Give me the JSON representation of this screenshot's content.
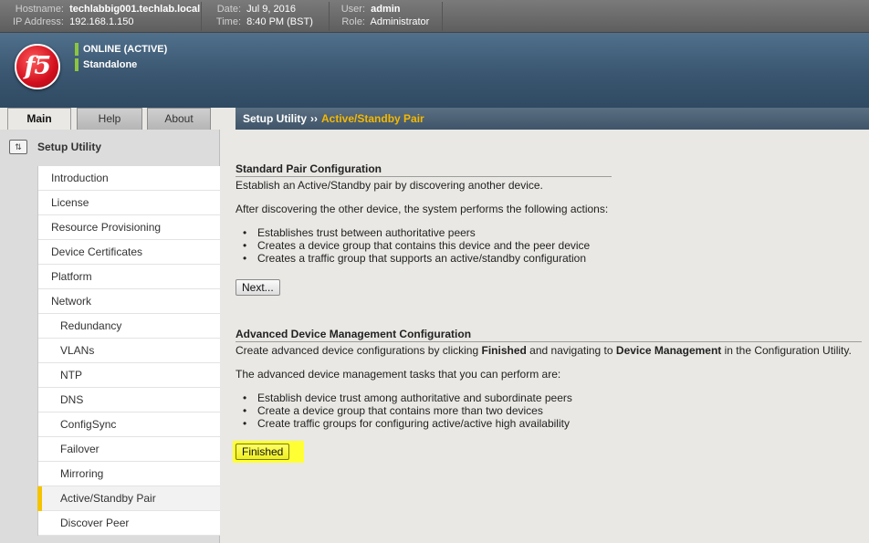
{
  "topbar": {
    "hostname_label": "Hostname:",
    "hostname": "techlabbig001.techlab.local",
    "ip_label": "IP Address:",
    "ip": "192.168.1.150",
    "date_label": "Date:",
    "date": "Jul 9, 2016",
    "time_label": "Time:",
    "time": "8:40 PM (BST)",
    "user_label": "User:",
    "user": "admin",
    "role_label": "Role:",
    "role": "Administrator"
  },
  "header": {
    "logo_text": "f5",
    "status_online": "ONLINE (ACTIVE)",
    "status_mode": "Standalone",
    "status_color": "#8cc63f"
  },
  "tabs": [
    {
      "label": "Main",
      "active": true
    },
    {
      "label": "Help",
      "active": false
    },
    {
      "label": "About",
      "active": false
    }
  ],
  "breadcrumb": {
    "root": "Setup Utility",
    "separator": "››",
    "current": "Active/Standby Pair"
  },
  "sidebar": {
    "title": "Setup Utility",
    "icon": "setup-utility-icon",
    "items": [
      {
        "label": "Introduction"
      },
      {
        "label": "License"
      },
      {
        "label": "Resource Provisioning"
      },
      {
        "label": "Device Certificates"
      },
      {
        "label": "Platform"
      },
      {
        "label": "Network"
      },
      {
        "label": "Redundancy"
      },
      {
        "label": "VLANs"
      },
      {
        "label": "NTP"
      },
      {
        "label": "DNS"
      },
      {
        "label": "ConfigSync"
      },
      {
        "label": "Failover"
      },
      {
        "label": "Mirroring"
      },
      {
        "label": "Active/Standby Pair"
      },
      {
        "label": "Discover Peer"
      }
    ]
  },
  "main": {
    "standard": {
      "title": "Standard Pair Configuration",
      "intro": "Establish an Active/Standby pair by discovering another device.",
      "actions_intro": "After discovering the other device, the system performs the following actions:",
      "bullets": [
        "Establishes trust between authoritative peers",
        "Creates a device group that contains this device and the peer device",
        "Creates a traffic group that supports an active/standby configuration"
      ],
      "button": "Next..."
    },
    "advanced": {
      "title": "Advanced Device Management Configuration",
      "intro_a": "Create advanced device configurations by clicking ",
      "intro_b": "Finished",
      "intro_c": " and navigating to ",
      "intro_d": "Device Management",
      "intro_e": " in the Configuration Utility.",
      "tasks_intro": "The advanced device management tasks that you can perform are:",
      "bullets": [
        "Establish device trust among authoritative and subordinate peers",
        "Create a device group that contains more than two devices",
        "Create traffic groups for configuring active/active high availability"
      ],
      "button": "Finished",
      "highlight_color": "#ffff33"
    }
  }
}
